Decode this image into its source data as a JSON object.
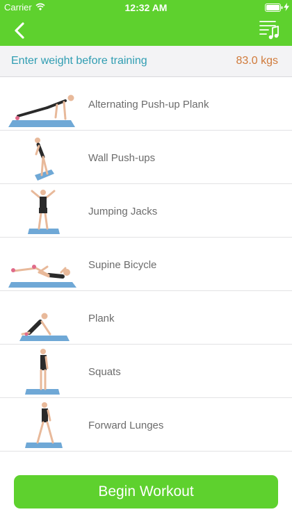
{
  "status_bar": {
    "carrier": "Carrier",
    "time": "12:32 AM"
  },
  "nav": {
    "back_icon": "chevron-left-icon",
    "music_icon": "music-playlist-icon",
    "bar_color": "#5ed12e"
  },
  "weight": {
    "label": "Enter weight before training",
    "value": "83.0 kgs"
  },
  "exercises": [
    {
      "name": "Alternating Push-up Plank"
    },
    {
      "name": "Wall Push-ups"
    },
    {
      "name": "Jumping Jacks"
    },
    {
      "name": "Supine Bicycle"
    },
    {
      "name": "Plank"
    },
    {
      "name": "Squats"
    },
    {
      "name": "Forward Lunges"
    }
  ],
  "footer": {
    "begin_label": "Begin Workout"
  }
}
